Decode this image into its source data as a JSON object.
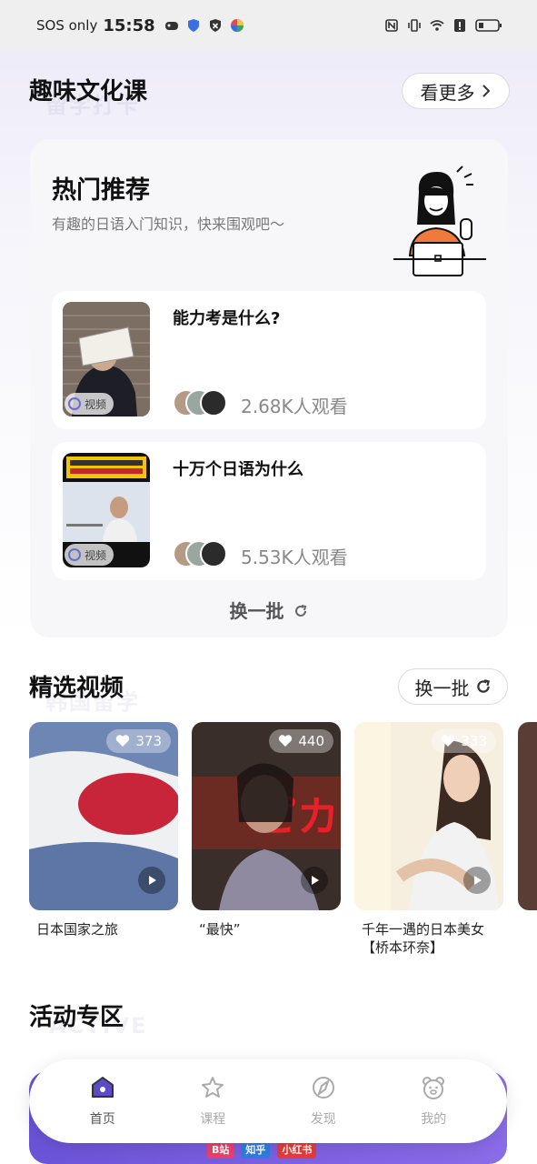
{
  "status": {
    "carrier": "SOS only",
    "time": "15:58"
  },
  "culture": {
    "title": "趣味文化课",
    "watermark": "留学打卡",
    "more_label": "看更多"
  },
  "hot": {
    "title": "热门推荐",
    "subtitle": "有趣的日语入门知识，快来围观吧～",
    "items": [
      {
        "title": "能力考是什么?",
        "badge": "视频",
        "views": "2.68K人观看"
      },
      {
        "title": "十万个日语为什么",
        "badge": "视频",
        "views": "5.53K人观看"
      }
    ],
    "refresh_label": "换一批"
  },
  "videos": {
    "title": "精选视频",
    "watermark": "韩国留学",
    "refresh_label": "换一批",
    "items": [
      {
        "title": "日本国家之旅",
        "likes": "373"
      },
      {
        "title": "“最快”",
        "likes": "440"
      },
      {
        "title": "千年一遇的日本美女【桥本环奈】",
        "likes": "333"
      }
    ]
  },
  "activity": {
    "title": "活动专区",
    "watermark": "ACTIVE",
    "banner_tags": [
      "B站",
      "知乎",
      "小红书"
    ]
  },
  "nav": [
    {
      "label": "首页",
      "icon": "home-icon",
      "active": true
    },
    {
      "label": "课程",
      "icon": "star-icon",
      "active": false
    },
    {
      "label": "发现",
      "icon": "compass-icon",
      "active": false
    },
    {
      "label": "我的",
      "icon": "bear-icon",
      "active": false
    }
  ],
  "colors": {
    "accent": "#6b53d8",
    "muted": "#888888"
  }
}
